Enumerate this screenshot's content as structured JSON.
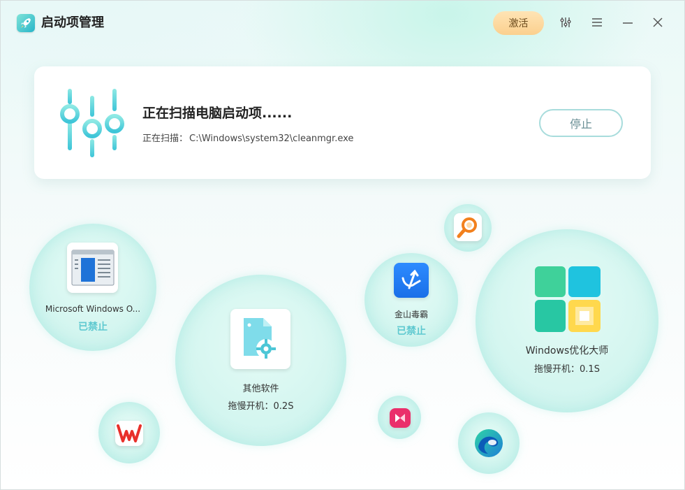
{
  "window": {
    "title": "启动项管理",
    "activate_label": "激活"
  },
  "scan": {
    "title": "正在扫描电脑启动项......",
    "path_label": "正在扫描：",
    "path_value": "C:\\Windows\\system32\\cleanmgr.exe",
    "stop_label": "停止"
  },
  "items": {
    "ms_windows": {
      "name": "Microsoft Windows O...",
      "status": "已禁止"
    },
    "other_software": {
      "name": "其他软件",
      "delay": "拖慢开机：0.2S"
    },
    "kingsoft": {
      "name": "金山毒霸",
      "status": "已禁止"
    },
    "win_optimizer": {
      "name": "Windows优化大师",
      "delay": "拖慢开机：0.1S"
    }
  },
  "icons": {
    "settings": "sliders-icon",
    "menu": "menu-icon",
    "minimize": "minimize-icon",
    "close": "close-icon"
  },
  "colors": {
    "accent": "#5fc9d0",
    "activate_bg": "#fbd08e",
    "card_bg": "#ffffff"
  }
}
